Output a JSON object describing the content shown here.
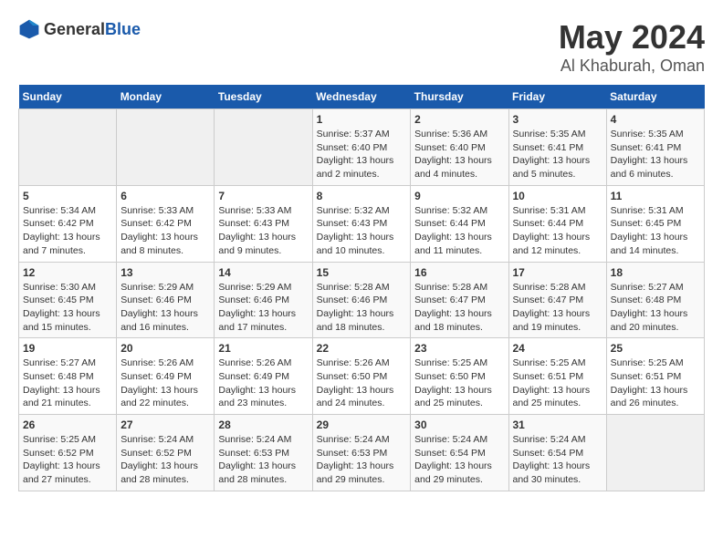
{
  "logo": {
    "text_general": "General",
    "text_blue": "Blue"
  },
  "title": {
    "month": "May 2024",
    "location": "Al Khaburah, Oman"
  },
  "days_header": [
    "Sunday",
    "Monday",
    "Tuesday",
    "Wednesday",
    "Thursday",
    "Friday",
    "Saturday"
  ],
  "weeks": [
    [
      {
        "day": "",
        "info": ""
      },
      {
        "day": "",
        "info": ""
      },
      {
        "day": "",
        "info": ""
      },
      {
        "day": "1",
        "info": "Sunrise: 5:37 AM\nSunset: 6:40 PM\nDaylight: 13 hours and 2 minutes."
      },
      {
        "day": "2",
        "info": "Sunrise: 5:36 AM\nSunset: 6:40 PM\nDaylight: 13 hours and 4 minutes."
      },
      {
        "day": "3",
        "info": "Sunrise: 5:35 AM\nSunset: 6:41 PM\nDaylight: 13 hours and 5 minutes."
      },
      {
        "day": "4",
        "info": "Sunrise: 5:35 AM\nSunset: 6:41 PM\nDaylight: 13 hours and 6 minutes."
      }
    ],
    [
      {
        "day": "5",
        "info": "Sunrise: 5:34 AM\nSunset: 6:42 PM\nDaylight: 13 hours and 7 minutes."
      },
      {
        "day": "6",
        "info": "Sunrise: 5:33 AM\nSunset: 6:42 PM\nDaylight: 13 hours and 8 minutes."
      },
      {
        "day": "7",
        "info": "Sunrise: 5:33 AM\nSunset: 6:43 PM\nDaylight: 13 hours and 9 minutes."
      },
      {
        "day": "8",
        "info": "Sunrise: 5:32 AM\nSunset: 6:43 PM\nDaylight: 13 hours and 10 minutes."
      },
      {
        "day": "9",
        "info": "Sunrise: 5:32 AM\nSunset: 6:44 PM\nDaylight: 13 hours and 11 minutes."
      },
      {
        "day": "10",
        "info": "Sunrise: 5:31 AM\nSunset: 6:44 PM\nDaylight: 13 hours and 12 minutes."
      },
      {
        "day": "11",
        "info": "Sunrise: 5:31 AM\nSunset: 6:45 PM\nDaylight: 13 hours and 14 minutes."
      }
    ],
    [
      {
        "day": "12",
        "info": "Sunrise: 5:30 AM\nSunset: 6:45 PM\nDaylight: 13 hours and 15 minutes."
      },
      {
        "day": "13",
        "info": "Sunrise: 5:29 AM\nSunset: 6:46 PM\nDaylight: 13 hours and 16 minutes."
      },
      {
        "day": "14",
        "info": "Sunrise: 5:29 AM\nSunset: 6:46 PM\nDaylight: 13 hours and 17 minutes."
      },
      {
        "day": "15",
        "info": "Sunrise: 5:28 AM\nSunset: 6:46 PM\nDaylight: 13 hours and 18 minutes."
      },
      {
        "day": "16",
        "info": "Sunrise: 5:28 AM\nSunset: 6:47 PM\nDaylight: 13 hours and 18 minutes."
      },
      {
        "day": "17",
        "info": "Sunrise: 5:28 AM\nSunset: 6:47 PM\nDaylight: 13 hours and 19 minutes."
      },
      {
        "day": "18",
        "info": "Sunrise: 5:27 AM\nSunset: 6:48 PM\nDaylight: 13 hours and 20 minutes."
      }
    ],
    [
      {
        "day": "19",
        "info": "Sunrise: 5:27 AM\nSunset: 6:48 PM\nDaylight: 13 hours and 21 minutes."
      },
      {
        "day": "20",
        "info": "Sunrise: 5:26 AM\nSunset: 6:49 PM\nDaylight: 13 hours and 22 minutes."
      },
      {
        "day": "21",
        "info": "Sunrise: 5:26 AM\nSunset: 6:49 PM\nDaylight: 13 hours and 23 minutes."
      },
      {
        "day": "22",
        "info": "Sunrise: 5:26 AM\nSunset: 6:50 PM\nDaylight: 13 hours and 24 minutes."
      },
      {
        "day": "23",
        "info": "Sunrise: 5:25 AM\nSunset: 6:50 PM\nDaylight: 13 hours and 25 minutes."
      },
      {
        "day": "24",
        "info": "Sunrise: 5:25 AM\nSunset: 6:51 PM\nDaylight: 13 hours and 25 minutes."
      },
      {
        "day": "25",
        "info": "Sunrise: 5:25 AM\nSunset: 6:51 PM\nDaylight: 13 hours and 26 minutes."
      }
    ],
    [
      {
        "day": "26",
        "info": "Sunrise: 5:25 AM\nSunset: 6:52 PM\nDaylight: 13 hours and 27 minutes."
      },
      {
        "day": "27",
        "info": "Sunrise: 5:24 AM\nSunset: 6:52 PM\nDaylight: 13 hours and 28 minutes."
      },
      {
        "day": "28",
        "info": "Sunrise: 5:24 AM\nSunset: 6:53 PM\nDaylight: 13 hours and 28 minutes."
      },
      {
        "day": "29",
        "info": "Sunrise: 5:24 AM\nSunset: 6:53 PM\nDaylight: 13 hours and 29 minutes."
      },
      {
        "day": "30",
        "info": "Sunrise: 5:24 AM\nSunset: 6:54 PM\nDaylight: 13 hours and 29 minutes."
      },
      {
        "day": "31",
        "info": "Sunrise: 5:24 AM\nSunset: 6:54 PM\nDaylight: 13 hours and 30 minutes."
      },
      {
        "day": "",
        "info": ""
      }
    ]
  ]
}
